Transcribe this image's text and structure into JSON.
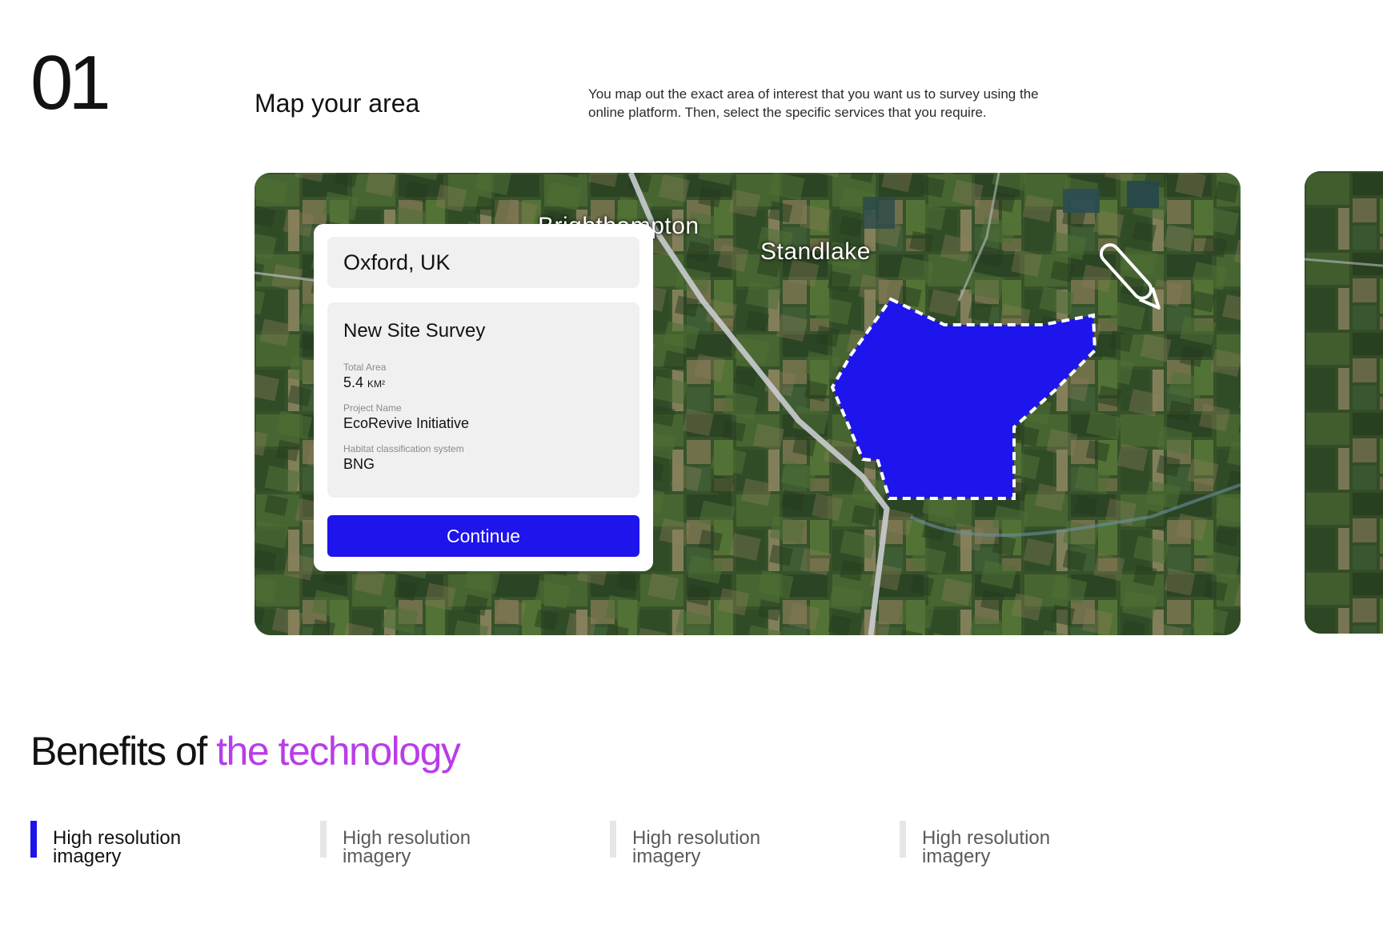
{
  "step": {
    "number": "01",
    "title": "Map your area",
    "description": "You map out the exact area of interest that you want us to survey using the online platform. Then, select the specific services that you require."
  },
  "map": {
    "labels": {
      "town_1": "Brighthampton",
      "town_2": "Standlake"
    },
    "polygon_color": "#1e14ec",
    "tool_icon": "pencil-icon"
  },
  "panel": {
    "location_value": "Oxford, UK",
    "survey_title": "New Site Survey",
    "total_area_label": "Total Area",
    "total_area_value": "5.4",
    "total_area_unit": "KM²",
    "project_name_label": "Project Name",
    "project_name_value": "EcoRevive Initiative",
    "habitat_label": "Habitat classification system",
    "habitat_value": "BNG",
    "continue_label": "Continue"
  },
  "benefits": {
    "heading_prefix": "Benefits of ",
    "heading_accent": "the technology",
    "items": [
      {
        "label": "High resolution imagery",
        "active": true
      },
      {
        "label": "High resolution imagery",
        "active": false
      },
      {
        "label": "High resolution imagery",
        "active": false
      },
      {
        "label": "High resolution imagery",
        "active": false
      }
    ]
  },
  "colors": {
    "accent_blue": "#1e14ec",
    "accent_purple": "#b83de8"
  }
}
